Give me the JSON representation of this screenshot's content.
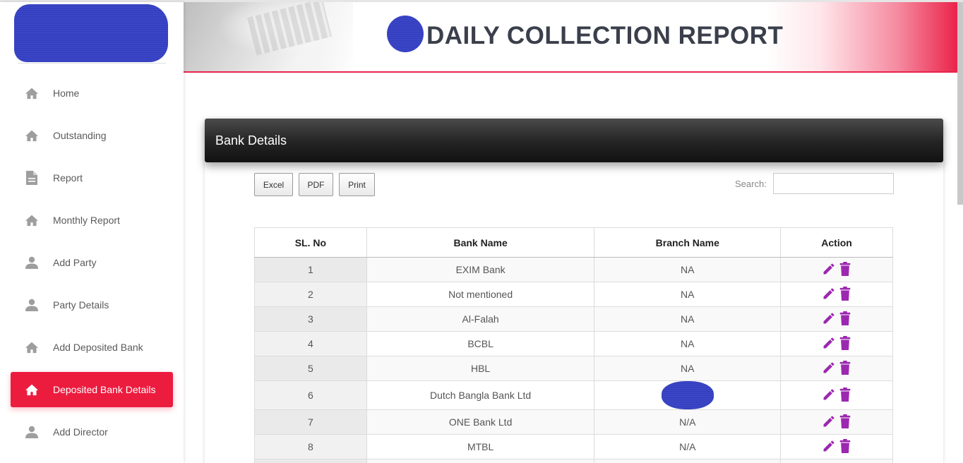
{
  "header": {
    "title": "DAILY COLLECTION REPORT"
  },
  "sidebar": {
    "items": [
      {
        "label": "Home",
        "icon": "home-icon"
      },
      {
        "label": "Outstanding",
        "icon": "home-icon"
      },
      {
        "label": "Report",
        "icon": "document-icon"
      },
      {
        "label": "Monthly Report",
        "icon": "home-icon"
      },
      {
        "label": "Add Party",
        "icon": "person-icon"
      },
      {
        "label": "Party Details",
        "icon": "person-icon"
      },
      {
        "label": "Add Deposited Bank",
        "icon": "home-icon"
      },
      {
        "label": "Deposited Bank Details",
        "icon": "home-icon",
        "active": true
      },
      {
        "label": "Add Director",
        "icon": "person-icon"
      }
    ]
  },
  "card": {
    "title": "Bank Details",
    "buttons": {
      "excel": "Excel",
      "pdf": "PDF",
      "print": "Print"
    },
    "search_label": "Search:"
  },
  "table": {
    "columns": [
      "SL. No",
      "Bank Name",
      "Branch Name",
      "Action"
    ],
    "rows": [
      {
        "sl": "1",
        "bank": "EXIM Bank",
        "branch": "NA"
      },
      {
        "sl": "2",
        "bank": "Not mentioned",
        "branch": "NA"
      },
      {
        "sl": "3",
        "bank": "Al-Falah",
        "branch": "NA"
      },
      {
        "sl": "4",
        "bank": "BCBL",
        "branch": "NA"
      },
      {
        "sl": "5",
        "bank": "HBL",
        "branch": "NA"
      },
      {
        "sl": "6",
        "bank": "Dutch Bangla Bank Ltd",
        "branch": ""
      },
      {
        "sl": "7",
        "bank": "ONE Bank Ltd",
        "branch": "N/A"
      },
      {
        "sl": "8",
        "bank": "MTBL",
        "branch": "N/A"
      },
      {
        "sl": "",
        "bank": "",
        "branch": ""
      }
    ]
  },
  "colors": {
    "accent": "#ec1c3f",
    "action_icon": "#9c27b0",
    "icon_gray": "#9e9e9e"
  }
}
